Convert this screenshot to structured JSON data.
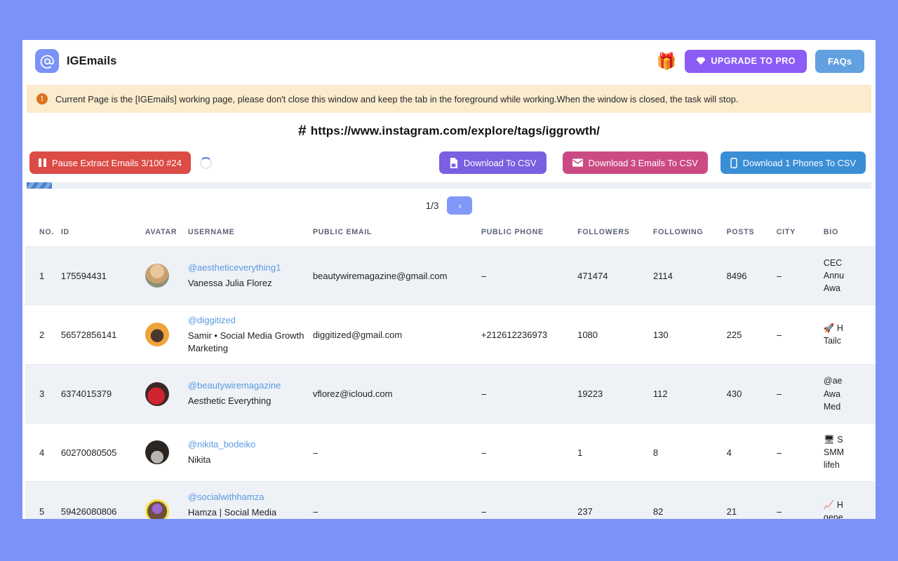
{
  "header": {
    "brand_name": "IGEmails",
    "logo_icon": "at-sign-icon",
    "gift_icon": "gift-icon",
    "upgrade_label": "UPGRADE TO PRO",
    "upgrade_icon": "diamond-icon",
    "faqs_label": "FAQs",
    "upgrade_color": "#8b5cf6",
    "faqs_color": "#63a0e0"
  },
  "notice": {
    "icon": "exclamation-circle-icon",
    "icon_glyph": "!",
    "text": "Current Page is the [IGEmails] working page, please don't close this window and keep the tab in the foreground while working.When the window is closed, the task will stop.",
    "background": "#fbeccd"
  },
  "url_bar": {
    "hash_icon": "hash-icon",
    "hash_glyph": "#",
    "url": "https://www.instagram.com/explore/tags/iggrowth/"
  },
  "toolbar": {
    "pause_label": "Pause Extract Emails 3/100 #24",
    "pause_icon": "pause-icon",
    "pause_color": "#dc4b45",
    "spinner_icon": "loading-spinner-icon",
    "download_csv_label": "Download To CSV",
    "download_csv_icon": "file-csv-icon",
    "download_csv_color": "#7a5fe0",
    "download_emails_label": "Download 3 Emails To CSV",
    "download_emails_icon": "envelope-icon",
    "download_emails_color": "#cc4a84",
    "download_phones_label": "Download 1 Phones To CSV",
    "download_phones_icon": "mobile-phone-icon",
    "download_phones_color": "#3a8ed6"
  },
  "progress": {
    "percent": 3
  },
  "pager": {
    "page_label": "1/3",
    "next_icon": "chevron-right-icon",
    "next_glyph": "›"
  },
  "table": {
    "columns": [
      "NO.",
      "ID",
      "AVATAR",
      "USERNAME",
      "PUBLIC EMAIL",
      "PUBLIC PHONE",
      "FOLLOWERS",
      "FOLLOWING",
      "POSTS",
      "CITY",
      "BIO"
    ],
    "rows": [
      {
        "no": "1",
        "id": "175594431",
        "avatar": "avatar-aestheticeverything1",
        "username": "@aestheticeverything1",
        "fullname": "Vanessa Julia Florez",
        "email": "beautywiremagazine@gmail.com",
        "phone": "--",
        "followers": "471474",
        "following": "2114",
        "posts": "8496",
        "city": "--",
        "bio_lines": [
          "CEC",
          "Annu",
          "Awa"
        ]
      },
      {
        "no": "2",
        "id": "56572856141",
        "avatar": "avatar-diggitized",
        "username": "@diggitized",
        "fullname": "Samir • Social Media Growth Marketing",
        "email": "diggitized@gmail.com",
        "phone": "+212612236973",
        "followers": "1080",
        "following": "130",
        "posts": "225",
        "city": "--",
        "bio_lines": [
          "🚀 H",
          "Tailс"
        ]
      },
      {
        "no": "3",
        "id": "6374015379",
        "avatar": "avatar-beautywiremagazine",
        "username": "@beautywiremagazine",
        "fullname": "Aesthetic Everything",
        "email": "vflorez@icloud.com",
        "phone": "--",
        "followers": "19223",
        "following": "112",
        "posts": "430",
        "city": "--",
        "bio_lines": [
          "@ae",
          "Awa",
          "Med"
        ]
      },
      {
        "no": "4",
        "id": "60270080505",
        "avatar": "avatar-nikita-bodeiko",
        "username": "@nikita_bodeiko",
        "fullname": "Nikita",
        "email": "--",
        "phone": "--",
        "followers": "1",
        "following": "8",
        "posts": "4",
        "city": "--",
        "bio_lines": [
          "🖥 S",
          "SMM",
          "lifeh"
        ]
      },
      {
        "no": "5",
        "id": "59426080806",
        "avatar": "avatar-socialwithhamza",
        "username": "@socialwithhamza",
        "fullname": "Hamza | Social Media Manager | Paid Ads",
        "email": "--",
        "phone": "--",
        "followers": "237",
        "following": "82",
        "posts": "21",
        "city": "--",
        "bio_lines": [
          "📈 H",
          "gene"
        ]
      }
    ]
  }
}
